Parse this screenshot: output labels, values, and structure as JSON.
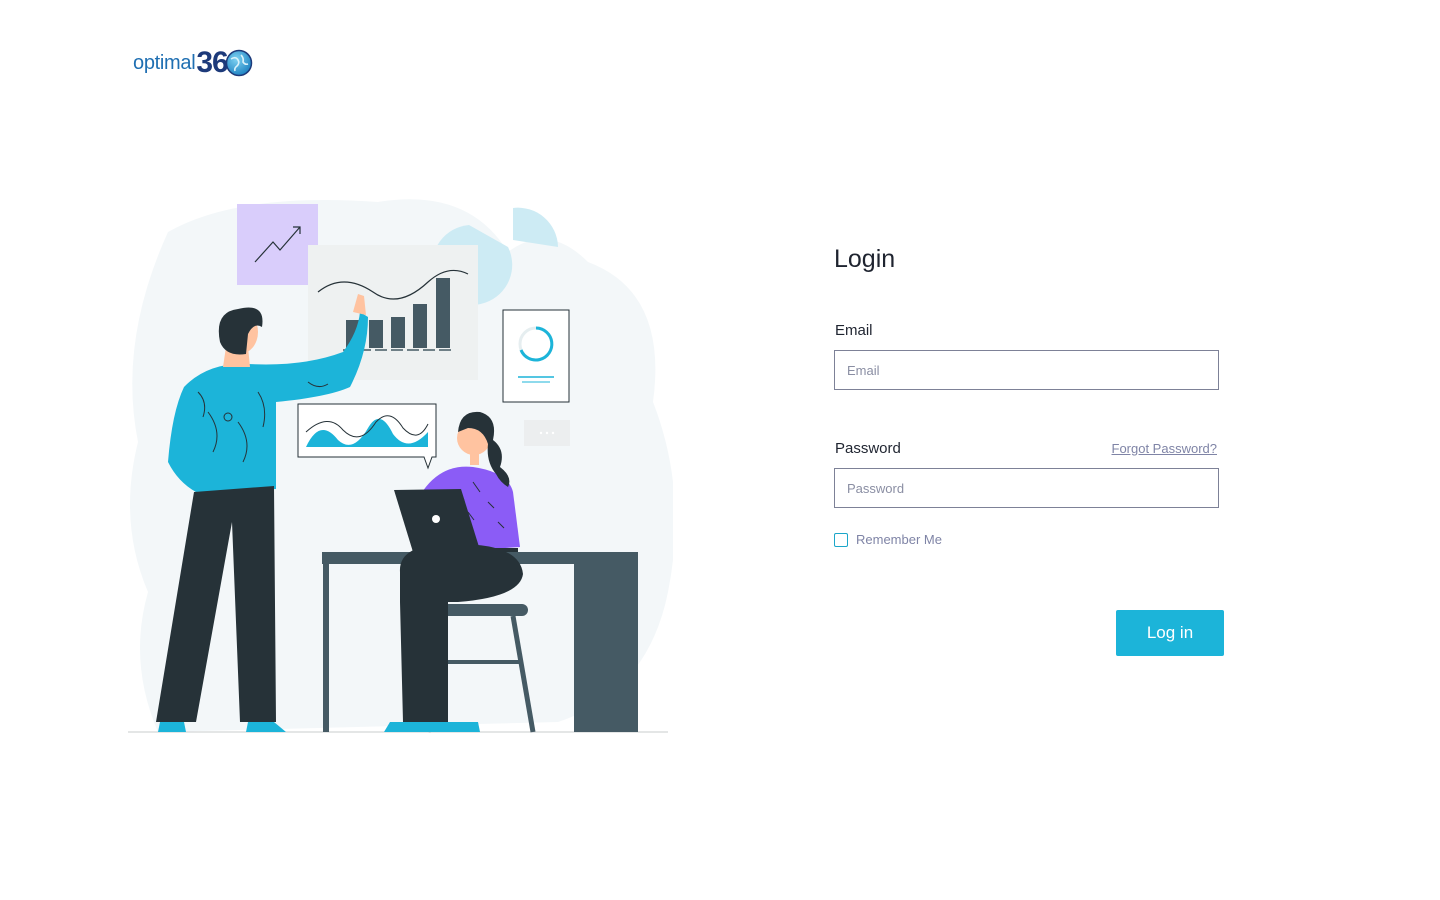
{
  "brand": {
    "name_word": "optimal",
    "name_number": "36",
    "logo_icon": "globe-icon",
    "colors": {
      "word": "#1f6fb2",
      "number": "#1d3a7a",
      "globe": "#2a9fd6"
    }
  },
  "login": {
    "title": "Login",
    "email": {
      "label": "Email",
      "placeholder": "Email",
      "value": ""
    },
    "password": {
      "label": "Password",
      "placeholder": "Password",
      "value": ""
    },
    "forgot_password": "Forgot Password?",
    "remember_me": {
      "label": "Remember Me",
      "checked": false
    },
    "submit_label": "Log in"
  },
  "colors": {
    "accent": "#1cb4d9",
    "input_border": "#7d8197",
    "muted_text": "#7f84a6",
    "illustration_bg": "#f4f7f9",
    "shirt_blue": "#1cb4d9",
    "shirt_purple": "#8b5cf6",
    "dark": "#263238"
  }
}
